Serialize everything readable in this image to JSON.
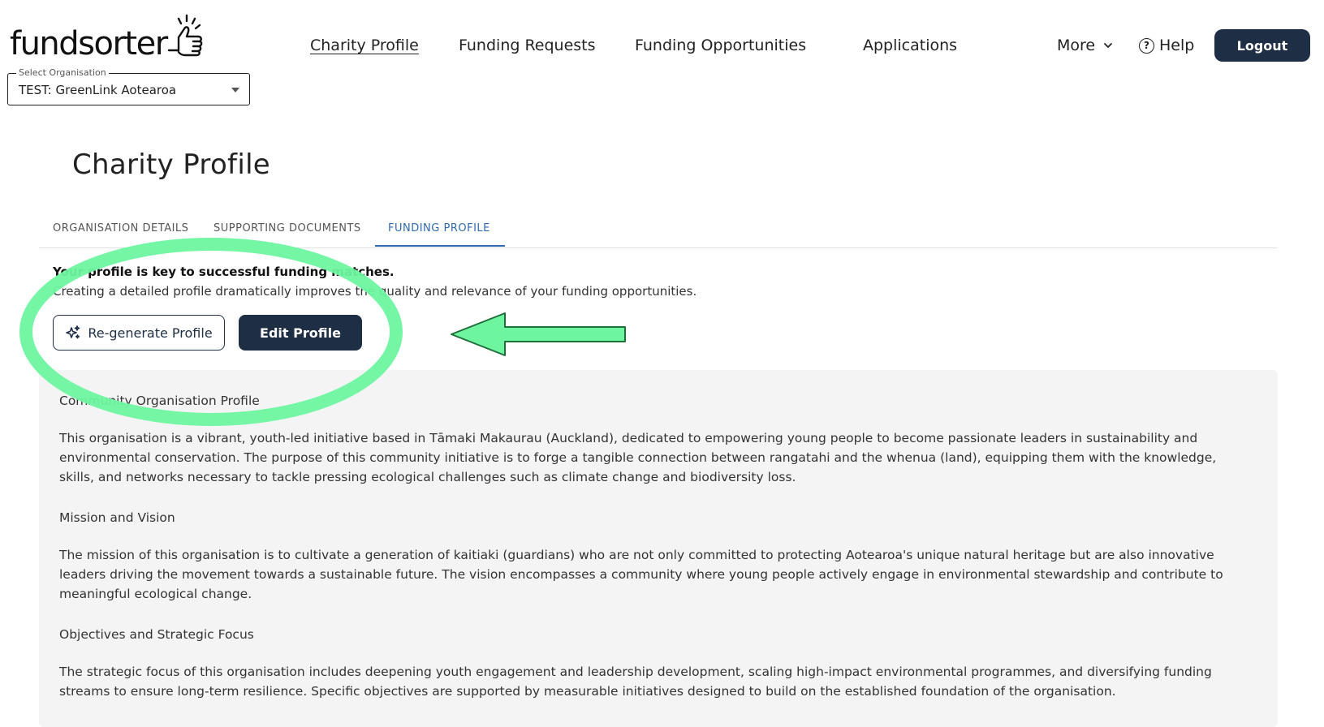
{
  "brand": {
    "name": "fundsorter",
    "icon": "thumbs-up-icon"
  },
  "org_select": {
    "label": "Select Organisation",
    "value": "TEST: GreenLink Aotearoa"
  },
  "nav": {
    "charity_profile": "Charity Profile",
    "funding_requests": "Funding Requests",
    "funding_opportunities": "Funding Opportunities",
    "applications": "Applications",
    "more": "More",
    "help": "Help",
    "logout": "Logout"
  },
  "page": {
    "title": "Charity Profile"
  },
  "tabs": [
    {
      "label": "ORGANISATION DETAILS",
      "active": false
    },
    {
      "label": "SUPPORTING DOCUMENTS",
      "active": false
    },
    {
      "label": "FUNDING PROFILE",
      "active": true
    }
  ],
  "intro": {
    "bold": "Your profile is key to successful funding matches.",
    "text": "Creating a detailed profile dramatically improves the quality and relevance of your funding opportunities."
  },
  "buttons": {
    "regenerate": "Re-generate Profile",
    "edit": "Edit Profile"
  },
  "profile": {
    "heading1": "Community Organisation Profile",
    "para1": "This organisation is a vibrant, youth-led initiative based in Tāmaki Makaurau (Auckland), dedicated to empowering young people to become passionate leaders in sustainability and environmental conservation. The purpose of this community initiative is to forge a tangible connection between rangatahi and the whenua (land), equipping them with the knowledge, skills, and networks necessary to tackle pressing ecological challenges such as climate change and biodiversity loss.",
    "heading2": "Mission and Vision",
    "para2": "The mission of this organisation is to cultivate a generation of kaitiaki (guardians) who are not only committed to protecting Aotearoa's unique natural heritage but are also innovative leaders driving the movement towards a sustainable future. The vision encompasses a community where young people actively engage in environmental stewardship and contribute to meaningful ecological change.",
    "heading3": "Objectives and Strategic Focus",
    "para3": "The strategic focus of this organisation includes deepening youth engagement and leadership development, scaling high-impact environmental programmes, and diversifying funding streams to ensure long-term resilience. Specific objectives are supported by measurable initiatives designed to build on the established foundation of the organisation."
  },
  "colors": {
    "primary": "#1d2e45",
    "accent_tab": "#2f6ab0",
    "annotation": "#6ef5a0",
    "panel_bg": "#f4f4f4"
  }
}
